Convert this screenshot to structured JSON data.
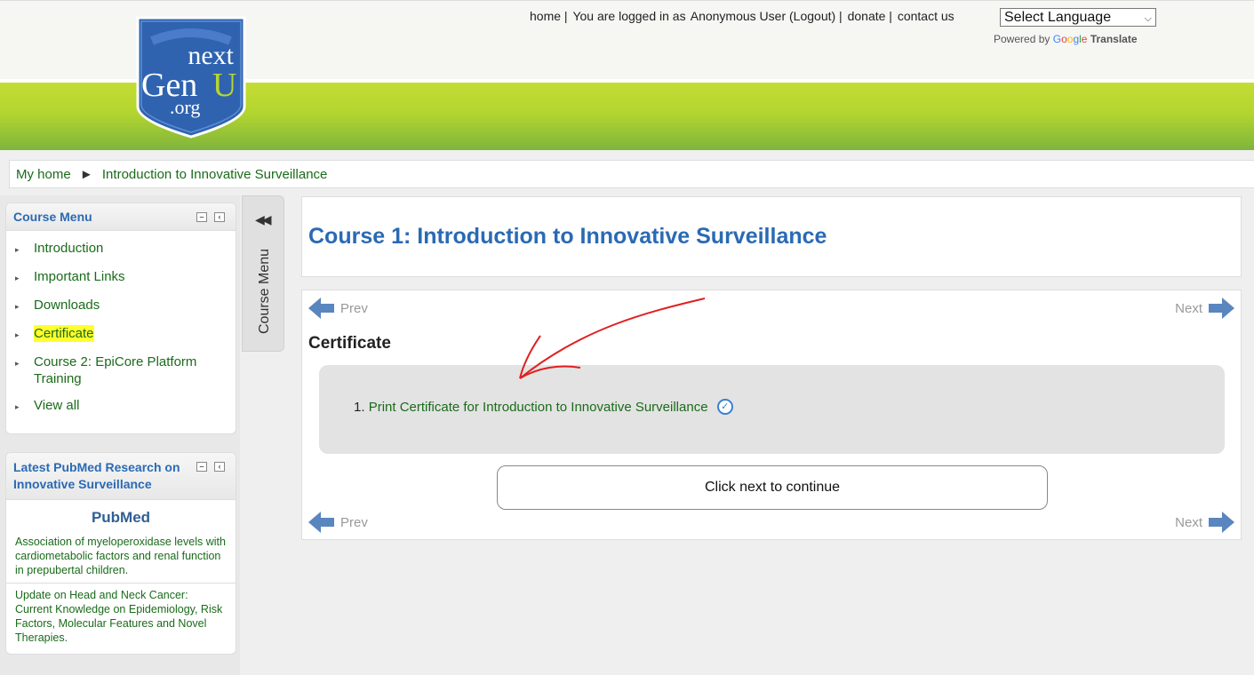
{
  "header": {
    "logo_text_1": "next",
    "logo_text_2": "Gen",
    "logo_text_3": "U",
    "logo_text_4": ".org",
    "links": {
      "home": "home",
      "logged_in_prefix": "You are logged in as",
      "user": "Anonymous User",
      "logout": "(Logout)",
      "donate": "donate",
      "contact": "contact us"
    },
    "language_select": "Select Language",
    "powered_by": "Powered by",
    "google": [
      "G",
      "o",
      "o",
      "g",
      "l",
      "e"
    ],
    "translate": "Translate"
  },
  "breadcrumb": {
    "home": "My home",
    "separator": "►",
    "current": "Introduction to Innovative Surveillance"
  },
  "course_menu": {
    "title": "Course Menu",
    "items": [
      {
        "label": "Introduction"
      },
      {
        "label": "Important Links"
      },
      {
        "label": "Downloads"
      },
      {
        "label": "Certificate",
        "highlight": "#ffff2e"
      },
      {
        "label": "Course 2: EpiCore Platform Training"
      },
      {
        "label": "View all"
      }
    ]
  },
  "pubmed_block": {
    "title": "Latest PubMed Research on Innovative Surveillance",
    "logo_pub": "Pub",
    "logo_med": "Med",
    "articles": [
      {
        "title": "Association of myeloperoxidase levels with cardiometabolic factors and renal function in prepubertal children."
      },
      {
        "title": "Update on Head and Neck Cancer: Current Knowledge on Epidemiology, Risk Factors, Molecular Features and Novel Therapies."
      }
    ]
  },
  "dock": {
    "label": "Course Menu",
    "arrows": "◀◀"
  },
  "main": {
    "course_title": "Course 1: Introduction to Innovative Surveillance",
    "prev": "Prev",
    "next": "Next",
    "section_title": "Certificate",
    "item_number": "1.",
    "item_link": "Print Certificate for Introduction to Innovative Surveillance",
    "continue_button": "Click next to continue"
  },
  "colors": {
    "link_green": "#1a6b1a",
    "title_blue": "#2a6ab4",
    "header_green": "#b3d52f",
    "annotation_red": "#e02020"
  }
}
